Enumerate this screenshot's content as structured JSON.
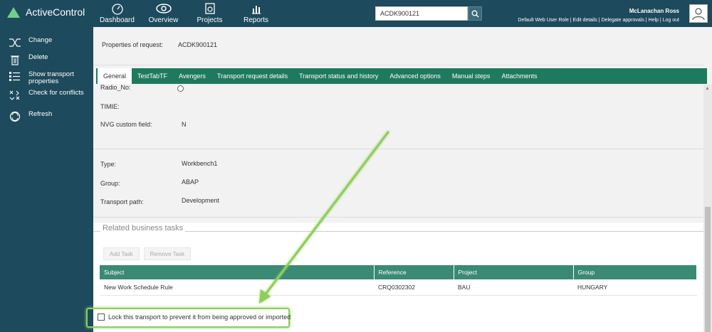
{
  "app": {
    "name": "ActiveControl"
  },
  "nav": [
    {
      "label": "Dashboard",
      "icon": "dashboard-icon"
    },
    {
      "label": "Overview",
      "icon": "eye-icon"
    },
    {
      "label": "Projects",
      "icon": "projects-icon"
    },
    {
      "label": "Reports",
      "icon": "reports-icon"
    }
  ],
  "search": {
    "value": "ACDK900121"
  },
  "user": {
    "name": "McLanachan Ross",
    "links": "Default Web User Role | Edit details | Delegate approvals | Help | Log out"
  },
  "sidebar": {
    "items": [
      {
        "label": "Change",
        "icon": "change-icon"
      },
      {
        "label": "Delete",
        "icon": "trash-icon"
      },
      {
        "label": "Show transport properties",
        "icon": "list-icon"
      },
      {
        "label": "Check for conflicts",
        "icon": "conflicts-icon"
      },
      {
        "label": "Refresh",
        "icon": "refresh-icon"
      }
    ]
  },
  "properties": {
    "label": "Properties of request:",
    "value": "ACDK900121"
  },
  "tabs": [
    "General",
    "TestTabTF",
    "Avengers",
    "Transport request details",
    "Transport status and history",
    "Advanced options",
    "Manual steps",
    "Attachments"
  ],
  "custom_fields": {
    "radio_label": "Radio_No:",
    "timie_label": "TIMIE:",
    "nvg_label": "NVG custom field:",
    "nvg_value": "N"
  },
  "details": {
    "type_label": "Type:",
    "type_value": "Workbench1",
    "group_label": "Group:",
    "group_value": "ABAP",
    "path_label": "Transport path:",
    "path_value": "Development"
  },
  "related": {
    "legend": "Related business tasks",
    "add_btn": "Add Task",
    "remove_btn": "Remove Task",
    "columns": [
      "Subject",
      "Reference",
      "Project",
      "Group"
    ],
    "rows": [
      [
        "New Work Schedule Rule",
        "CRQ0302302",
        "BAU",
        "HUNGARY"
      ]
    ]
  },
  "lock": {
    "label": "Lock this transport to prevent it from being approved or imported"
  },
  "colors": {
    "header": "#1d4a5c",
    "tabs": "#1e7a5e",
    "accent": "#6fd08a",
    "highlight": "#8fce5a"
  }
}
